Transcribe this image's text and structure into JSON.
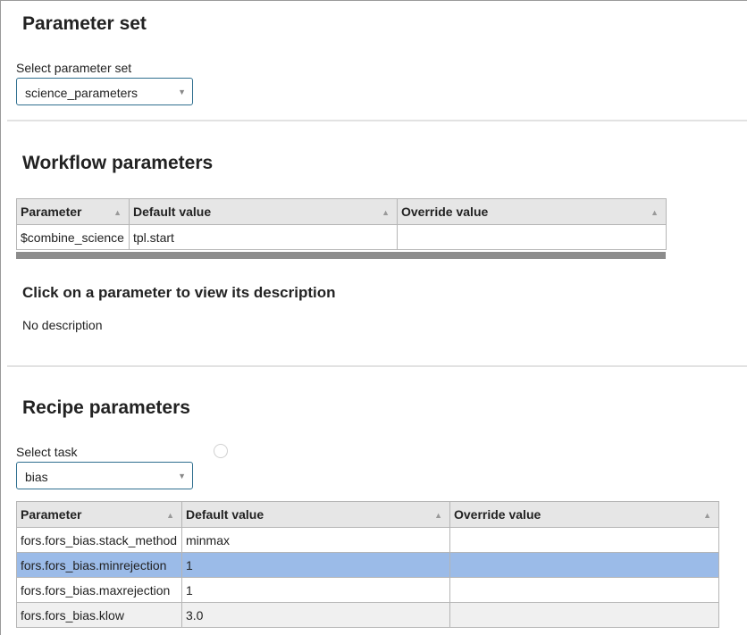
{
  "parameter_set": {
    "title": "Parameter set",
    "select_label": "Select parameter set",
    "selected": "science_parameters"
  },
  "workflow": {
    "title": "Workflow parameters",
    "columns": [
      "Parameter",
      "Default value",
      "Override value"
    ],
    "rows": [
      {
        "parameter": "$combine_science",
        "default": "tpl.start",
        "override": ""
      }
    ],
    "description_title": "Click on a parameter to view its description",
    "description_text": "No description"
  },
  "recipe": {
    "title": "Recipe parameters",
    "select_label": "Select task",
    "selected_task": "bias",
    "columns": [
      "Parameter",
      "Default value",
      "Override value"
    ],
    "rows": [
      {
        "parameter": "fors.fors_bias.stack_method",
        "default": "minmax",
        "override": "",
        "selected": false
      },
      {
        "parameter": "fors.fors_bias.minrejection",
        "default": "1",
        "override": "",
        "selected": true
      },
      {
        "parameter": "fors.fors_bias.maxrejection",
        "default": "1",
        "override": "",
        "selected": false
      },
      {
        "parameter": "fors.fors_bias.klow",
        "default": "3.0",
        "override": "",
        "selected": false
      }
    ]
  },
  "icons": {
    "sort": "sort-asc-icon",
    "dropdown": "chevron-down-icon",
    "loading": "loading-spinner-icon"
  },
  "colors": {
    "select_border": "#2f6f8f",
    "selected_row": "#9bbbe8",
    "header_bg": "#e6e6e6"
  }
}
